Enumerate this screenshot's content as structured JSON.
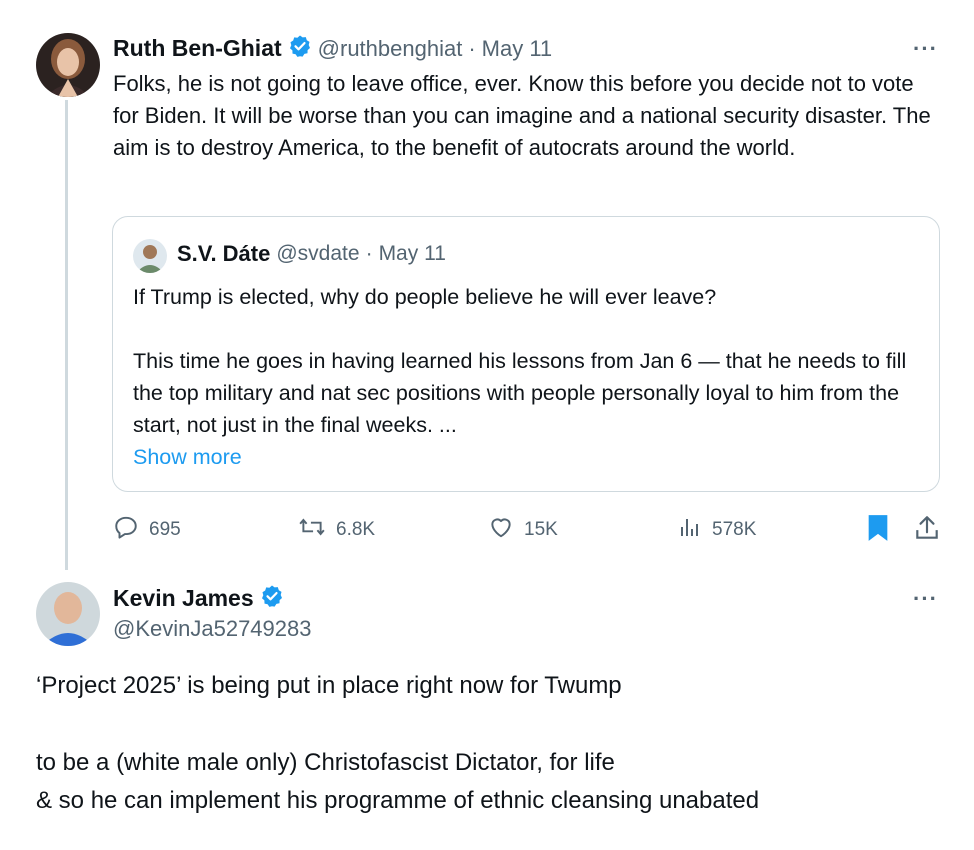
{
  "tweet": {
    "author_name": "Ruth Ben-Ghiat",
    "handle": "@ruthbenghiat",
    "date_sep": "·",
    "date": "May 11",
    "more": "···",
    "text": "Folks, he is not going to leave office, ever. Know this before you decide not to vote for Biden. It will be worse than you can imagine and a national security disaster. The aim is to destroy America, to the benefit of autocrats around the world.",
    "quote": {
      "author_name": "S.V. Dáte",
      "handle": "@svdate",
      "date_sep": "·",
      "date": "May 11",
      "text_p1": "If Trump is elected, why do people believe he will ever leave?",
      "text_p2": "This time he goes in having learned his lessons from Jan 6 — that he needs to fill the top military and nat sec positions with people personally loyal to him from the start, not just in the final weeks. ...",
      "show_more": "Show more"
    },
    "actions": {
      "replies": "695",
      "reposts": "6.8K",
      "likes": "15K",
      "views": "578K"
    }
  },
  "reply": {
    "author_name": "Kevin James",
    "handle": "@KevinJa52749283",
    "more": "···",
    "line1": "‘Project 2025’ is being put in place right now for Twump",
    "line2": "to be a (white male only) Christofascist Dictator, for life",
    "line3": "& so he can implement his programme of ethnic cleansing unabated"
  },
  "colors": {
    "accent": "#1d9bf0",
    "text": "#0f1419",
    "muted": "#536471",
    "border": "#cfd9de"
  },
  "icons": [
    "verified-badge-icon",
    "more-icon",
    "reply-icon",
    "repost-icon",
    "like-icon",
    "views-icon",
    "bookmark-icon",
    "share-icon"
  ]
}
